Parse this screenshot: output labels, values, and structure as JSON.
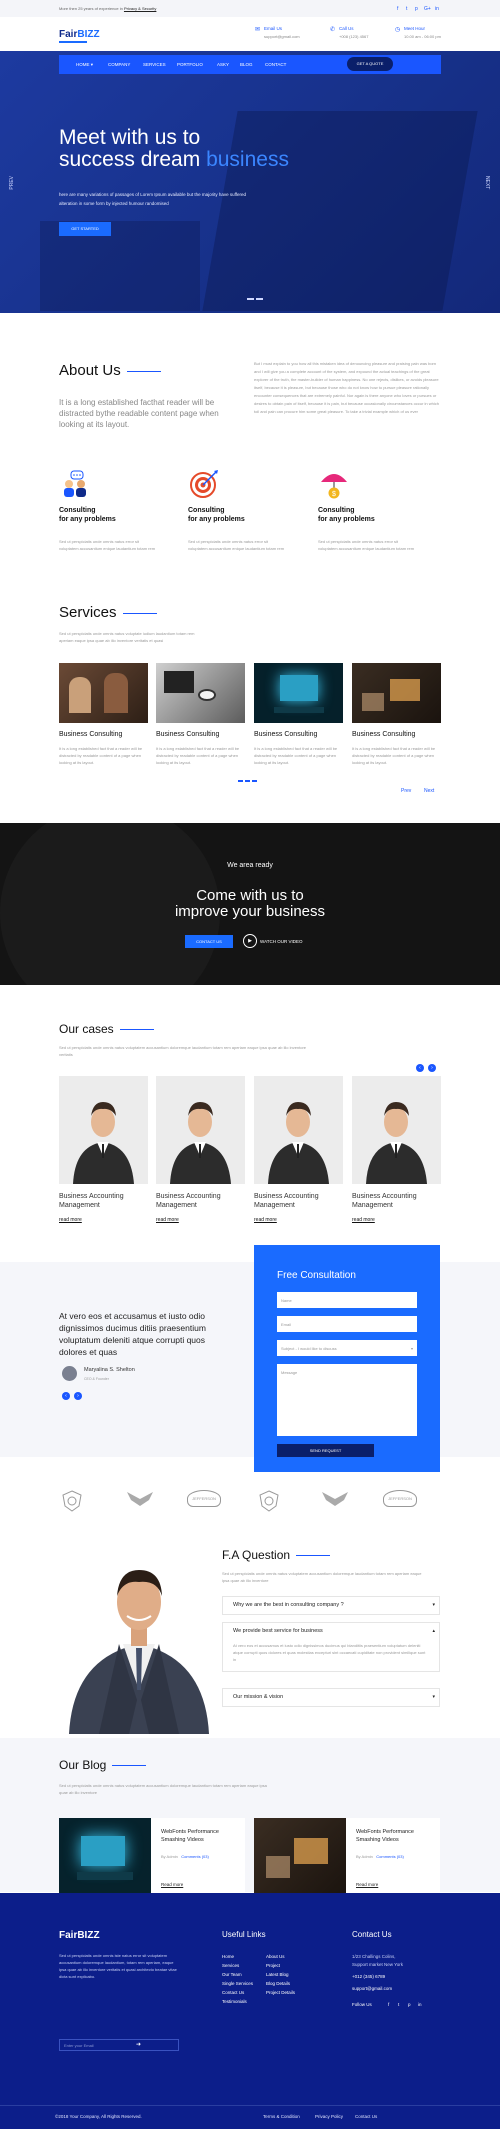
{
  "topbar": {
    "text_prefix": "More then 25 years of experience in",
    "text_link": "Privacy & Security",
    "social": [
      "f",
      "t",
      "p",
      "G+",
      "in"
    ]
  },
  "header": {
    "logo": "FairBIZZ",
    "email_label": "Email Us",
    "email_value": "support@gmail.com",
    "call_label": "Call Us",
    "call_value": "+008 (123) 4567",
    "meet_label": "Meet Hour",
    "meet_value": "10.00 am - 06:00 pm"
  },
  "nav": {
    "items": [
      "HOME ▾",
      "COMPANY",
      "SERVICES",
      "PORTFOLIO",
      "ASKY",
      "BLOG",
      "CONTACT"
    ],
    "cta": "GET A QUOTE"
  },
  "hero": {
    "title_line1": "Meet with us to",
    "title_line2": "success dream",
    "title_highlight": "business",
    "text": "here are many variations of passages of Lorem Ipsum available but the majority have suffered alteration in some form by injected humour randomised",
    "button": "GET STARTED",
    "prev": "PREV",
    "next": "NEXT"
  },
  "about": {
    "title": "About Us",
    "lead": "It is a long established facthat reader will be distracted bythe readable content page when looking at its layout.",
    "text": "But I must explain to you how all this mistaken idea of denouncing pleasure and praising pain was born and I will give you a complete account of the system, and expound the actual teachings of the great explorer of the truth, the master-builder of human happiness. No one rejects, dislikes, or avoids pleasure itself, because it is pleasure, but because those who do not know how to pursue pleasure rationally encounter consequences that are extremely painful. Nor again is there anyone who loves or pursues or desires to obtain pain of itself, because it is pain, but because occasionally circumstances occur in which toil and pain can procure him some great pleasure. To take a trivial example which of us ever"
  },
  "features": [
    {
      "icon": "consulting-people-icon",
      "title1": "Consulting",
      "title2": "for any problems",
      "text": "Sed ut perspiciatis unde omnis natus error sit voluptatem accusantium enique laudantium totam rem"
    },
    {
      "icon": "target-icon",
      "title1": "Consulting",
      "title2": "for any problems",
      "text": "Sed ut perspiciatis unde omnis natus error sit voluptatem accusantium enique laudantium totam rem"
    },
    {
      "icon": "umbrella-money-icon",
      "title1": "Consulting",
      "title2": "for any problems",
      "text": "Sed ut perspiciatis unde omnis natus error sit voluptatem accusantium enique laudantium totam rem"
    }
  ],
  "services": {
    "title": "Services",
    "sub": "Sed ut perspiciatis unde omnis natus voluptate iudium laudantium totam rem aperiam eaque ipsa quae ab illo inventore veritatis et quasi",
    "cards": [
      {
        "title": "Business Consulting",
        "text": "It is a long established fact that a reader will be distracted by readable content of a page when looking at its layout."
      },
      {
        "title": "Business Consulting",
        "text": "It is a long established fact that a reader will be distracted by readable content of a page when looking at its layout."
      },
      {
        "title": "Business Consulting",
        "text": "It is a long established fact that a reader will be distracted by readable content of a page when looking at its layout."
      },
      {
        "title": "Business Consulting",
        "text": "It is a long established fact that a reader will be distracted by readable content of a page when looking at its layout."
      }
    ],
    "prev": "Prev",
    "next": "Next"
  },
  "cta": {
    "small": "We area ready",
    "big1": "Come with us to",
    "big2": "improve your business",
    "button": "CONTACT US",
    "watch": "WATCH OUR VIDEO"
  },
  "cases": {
    "title": "Our cases",
    "sub": "Sed ut perspiciatis unde omnis natus voluptatem accusantium doloremque laudantium totam rem aperiam eaque ipsa quae ab illo inventore veritatis",
    "items": [
      {
        "title1": "Business Accounting",
        "title2": "Management",
        "link": "read more"
      },
      {
        "title1": "Business Accounting",
        "title2": "Management",
        "link": "read more"
      },
      {
        "title1": "Business Accounting",
        "title2": "Management",
        "link": "read more"
      },
      {
        "title1": "Business Accounting",
        "title2": "Management",
        "link": "read more"
      }
    ]
  },
  "testimonial": {
    "quote": "At vero eos et accusamus et iusto odio dignissimos ducimus ditiis praesentium voluptatum deleniti atque corrupti quos dolores et quas",
    "name": "Maryalina S. Shelton",
    "role": "CEO & Founder"
  },
  "form": {
    "title": "Free Consultation",
    "name": "Name",
    "email": "Email",
    "subject": "Subject - I would like to discuss",
    "message": "Message",
    "submit": "SEND REQUEST"
  },
  "brands": [
    "BRAND",
    "WINGS",
    "JEFFERSON",
    "BRAND",
    "WINGS",
    "JEFFERSON"
  ],
  "faq": {
    "title": "F.A Question",
    "sub": "Sed ut perspiciatis unde omnis natus voluptatem accusantium doloremque laudantium totam rem aperiam eaque ipsa quae ab illo inventore",
    "q1": "Why we are the best in consulting company ?",
    "q2": "We provide best service for business",
    "a2": "At vero eos et accusamus et iusto odio dignissimos ducimus qui blanditiis praesentium voluptatum deleniti atque corrupti quos dolores et quas molestias excepturi sint occaecati cupiditate non provident similique sunt in",
    "q3": "Our mission & vision"
  },
  "blog": {
    "title": "Our Blog",
    "sub": "Sed ut perspiciatis unde omnis natus voluptatem accusantium doloremque laudantium totam rem aperiam eaque ipsa quae ab illo inventore",
    "posts": [
      {
        "title": "WebFonts Performance Smashing Videos",
        "by": "By Admin",
        "comments": "Comments (03)",
        "link": "Read more"
      },
      {
        "title": "WebFonts Performance Smashing Videos",
        "by": "By Admin",
        "comments": "Comments (03)",
        "link": "Read more"
      }
    ]
  },
  "footer": {
    "logo": "FairBIZZ",
    "text": "Sed ut perspiciatis unde omnis iste natus error sit voluptatem accusantium doloremque laudantium, totam rem aperiam, eaque ipsa quae ab illo inventore veritatis et quasi architecto beatae vitae dicta sunt explicabo.",
    "email_placeholder": "Enter your Email",
    "useful_title": "Useful Links",
    "links_col1": [
      "Home",
      "Services",
      "Our Team",
      "Single Services",
      "Contact Us",
      "Testimonials"
    ],
    "links_col2": [
      "About Us",
      "Project",
      "Latest Blog",
      "Blog Details",
      "Project Details"
    ],
    "contact_title": "Contact Us",
    "address1": "1/23 Challings Colins,",
    "address2": "Support market New York",
    "phone": "+012 (345) 6789",
    "email": "support@gmail.com",
    "follow": "Follow Us",
    "copyright": "©2018 Your Company, All Rights Reserved.",
    "bottom_links": [
      "Terms & Condition",
      "Privacy Policy",
      "Contact Us"
    ]
  }
}
